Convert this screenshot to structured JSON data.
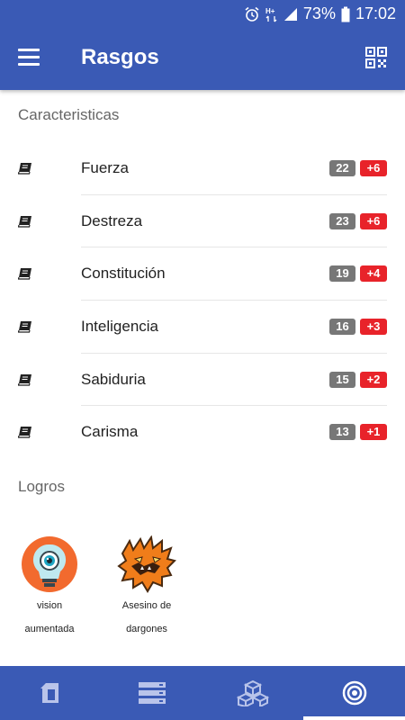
{
  "status_bar": {
    "battery_percent": "73%",
    "time": "17:02",
    "icons": [
      "alarm-icon",
      "hplus-icon",
      "signal-icon",
      "battery-icon"
    ]
  },
  "toolbar": {
    "title": "Rasgos",
    "menu_icon": "menu-icon",
    "qr_icon": "qr-code-icon"
  },
  "characteristics": {
    "heading": "Caracteristicas",
    "items": [
      {
        "label": "Fuerza",
        "score": "22",
        "modifier": "+6"
      },
      {
        "label": "Destreza",
        "score": "23",
        "modifier": "+6"
      },
      {
        "label": "Constitución",
        "score": "19",
        "modifier": "+4"
      },
      {
        "label": "Inteligencia",
        "score": "16",
        "modifier": "+3"
      },
      {
        "label": "Sabiduria",
        "score": "15",
        "modifier": "+2"
      },
      {
        "label": "Carisma",
        "score": "13",
        "modifier": "+1"
      }
    ]
  },
  "achievements": {
    "heading": "Logros",
    "items": [
      {
        "line1": "vision",
        "line2": "aumentada",
        "icon": "eye-bulb-icon"
      },
      {
        "line1": "Asesino de",
        "line2": "dargones",
        "icon": "dragon-icon"
      }
    ]
  },
  "bottom_nav": {
    "items": [
      "character-icon",
      "storage-icon",
      "cubes-icon",
      "target-icon"
    ],
    "selected_index": 3
  },
  "colors": {
    "primary": "#3a5ab5",
    "modifier_badge": "#e8232a",
    "score_badge": "#777777"
  }
}
